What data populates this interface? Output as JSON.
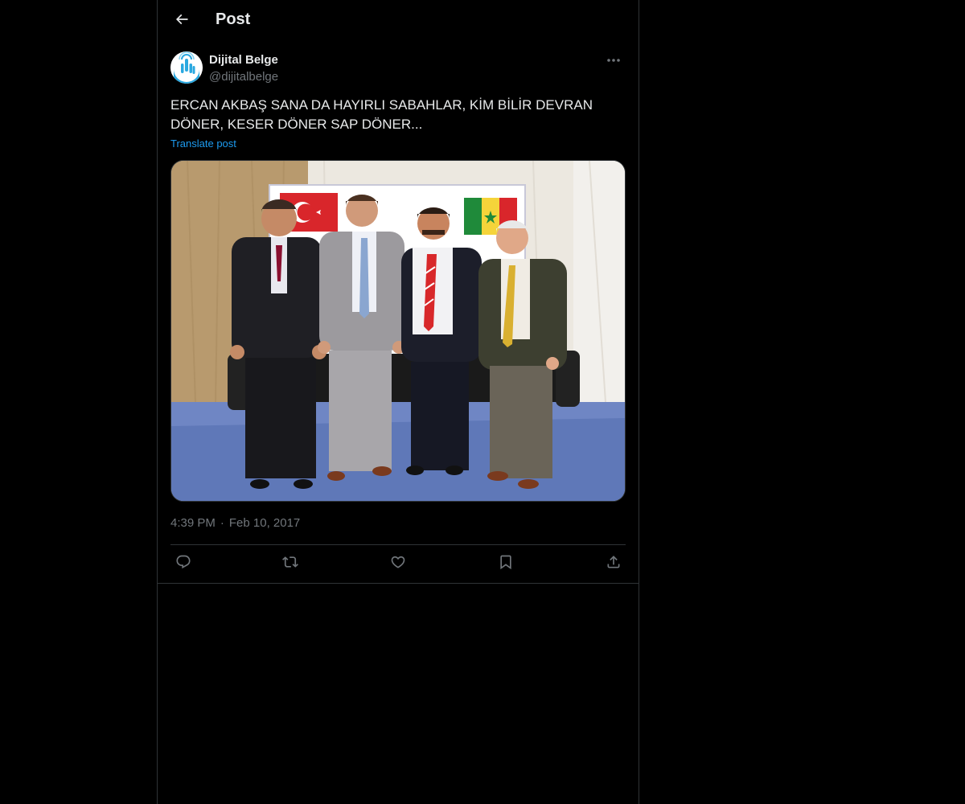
{
  "header": {
    "title": "Post",
    "back_icon": "arrow-left-icon"
  },
  "author": {
    "name": "Dijital Belge",
    "handle": "@dijitalbelge",
    "avatar_icon": "hand-touch-logo",
    "more_icon": "more-horizontal-icon"
  },
  "post": {
    "text": "ERCAN AKBAŞ SANA DA HAYIRLI SABAHLAR, KİM BİLİR DEVRAN DÖNER, KESER DÖNER SAP DÖNER...",
    "translate_label": "Translate post",
    "image_description_icon": "photo",
    "time": "4:39 PM",
    "separator": "·",
    "date": "Feb 10, 2017"
  },
  "actions": [
    {
      "name": "reply",
      "icon": "reply-icon"
    },
    {
      "name": "repost",
      "icon": "repost-icon"
    },
    {
      "name": "like",
      "icon": "heart-icon"
    },
    {
      "name": "bookmark",
      "icon": "bookmark-icon"
    },
    {
      "name": "share",
      "icon": "share-icon"
    }
  ],
  "colors": {
    "background": "#000000",
    "text": "#e7e9ea",
    "secondary": "#71767b",
    "accent": "#1d9bf0",
    "border": "#2f3336"
  }
}
